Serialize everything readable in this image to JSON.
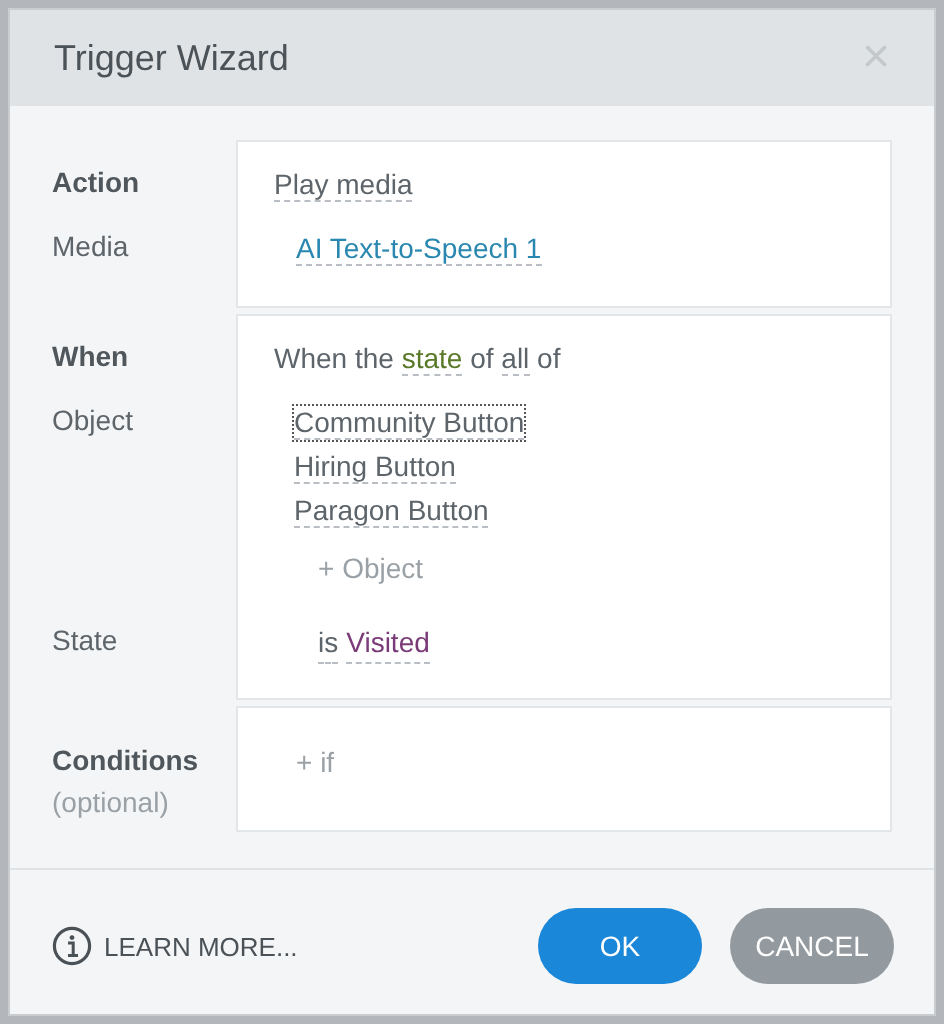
{
  "dialog": {
    "title": "Trigger Wizard",
    "close": "×"
  },
  "action": {
    "heading": "Action",
    "value": "Play media",
    "media_label": "Media",
    "media": "AI Text-to-Speech 1"
  },
  "when": {
    "heading": "When",
    "sentence": [
      {
        "text": "When the ",
        "kind": "plain"
      },
      {
        "text": "state",
        "kind": "state"
      },
      {
        "text": " of ",
        "kind": "plain"
      },
      {
        "text": "all",
        "kind": "quantifier"
      },
      {
        "text": " of",
        "kind": "plain"
      }
    ],
    "object_label": "Object",
    "objects": [
      {
        "name": "Community Button",
        "focused": true
      },
      {
        "name": "Hiring Button",
        "focused": false
      },
      {
        "name": "Paragon Button",
        "focused": false
      }
    ],
    "add_object": "+ Object",
    "state_label": "State",
    "state_is": "is",
    "state_value": "Visited"
  },
  "conditions": {
    "heading": "Conditions",
    "note": "(optional)",
    "add": "+ if"
  },
  "footer": {
    "learn_more": "LEARN MORE...",
    "buttons": [
      {
        "label": "OK",
        "kind": "primary"
      },
      {
        "label": "CANCEL",
        "kind": "secondary"
      }
    ]
  }
}
